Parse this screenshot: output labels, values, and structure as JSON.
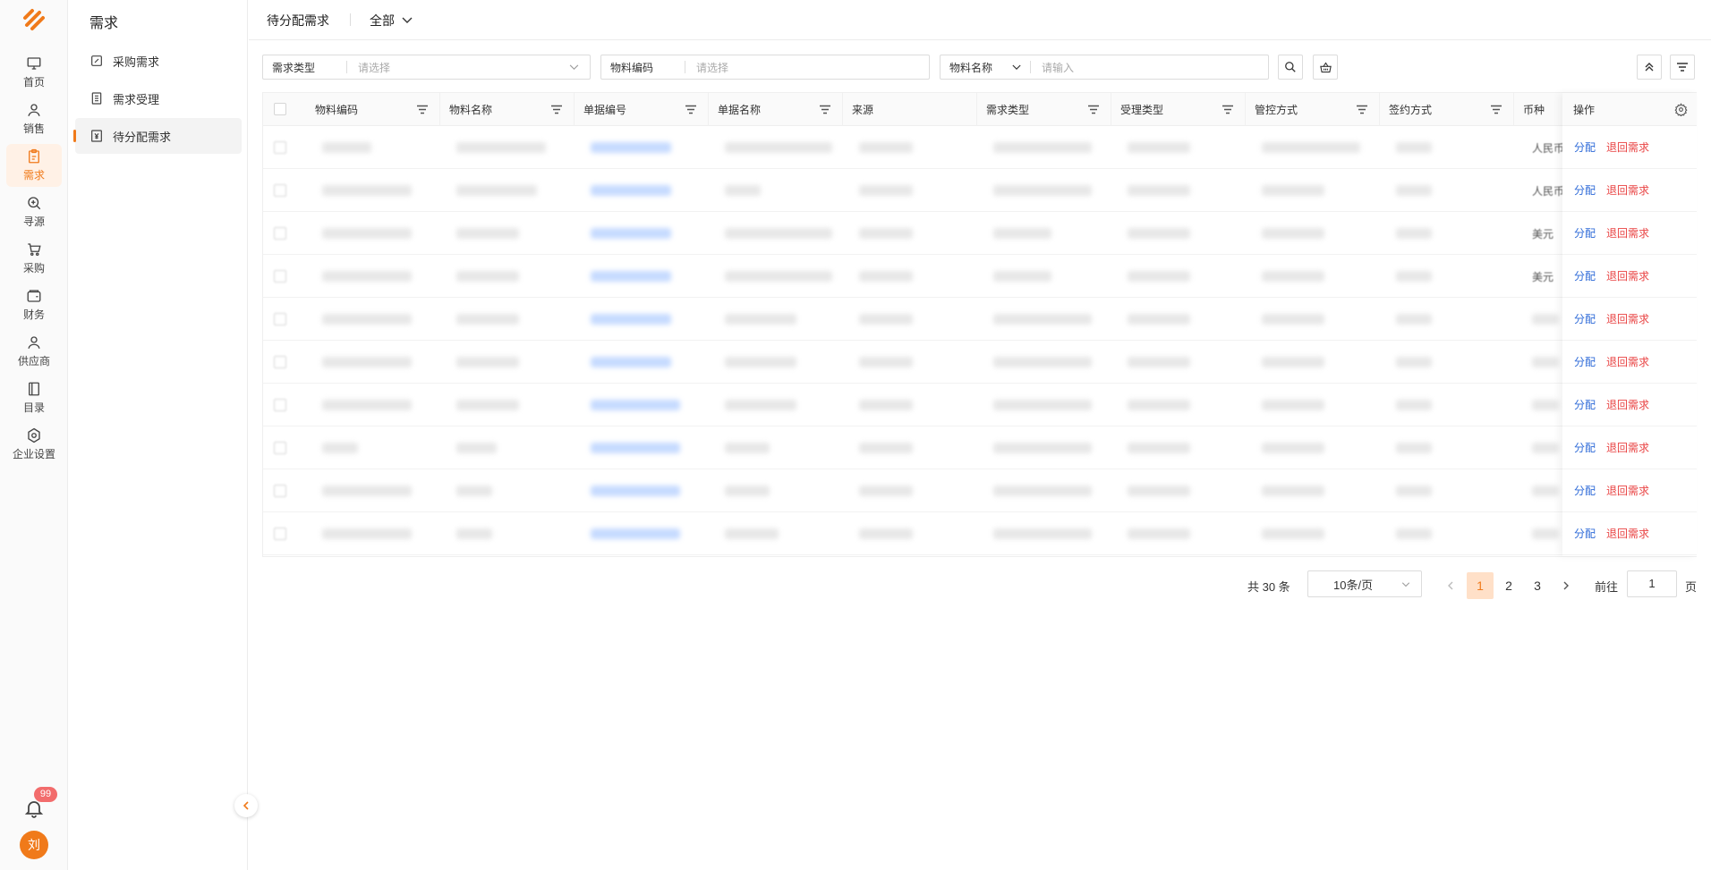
{
  "rail": {
    "items": [
      {
        "label": "首页",
        "icon": "monitor-icon"
      },
      {
        "label": "销售",
        "icon": "person-icon"
      },
      {
        "label": "需求",
        "icon": "clipboard-icon"
      },
      {
        "label": "寻源",
        "icon": "search-icon"
      },
      {
        "label": "采购",
        "icon": "cart-icon"
      },
      {
        "label": "财务",
        "icon": "wallet-icon"
      },
      {
        "label": "供应商",
        "icon": "supplier-icon"
      },
      {
        "label": "目录",
        "icon": "book-icon"
      },
      {
        "label": "企业设置",
        "icon": "settings-icon"
      }
    ],
    "active_index": 2,
    "notification_count": "99",
    "avatar_text": "刘",
    "accent": "#f07a1a"
  },
  "subnav": {
    "title": "需求",
    "items": [
      {
        "label": "采购需求",
        "icon": "edit-square-icon"
      },
      {
        "label": "需求受理",
        "icon": "list-icon"
      },
      {
        "label": "待分配需求",
        "icon": "yen-icon"
      }
    ],
    "active_index": 2
  },
  "header": {
    "title": "待分配需求",
    "scope": "全部"
  },
  "filters": {
    "type_label": "需求类型",
    "type_placeholder": "请选择",
    "code_label": "物料编码",
    "code_placeholder": "请选择",
    "name_label": "物料名称",
    "name_placeholder": "请输入"
  },
  "table": {
    "columns": [
      "物料编码",
      "物料名称",
      "单据编号",
      "单据名称",
      "来源",
      "需求类型",
      "受理类型",
      "管控方式",
      "签约方式",
      "币种"
    ],
    "action_header": "操作",
    "currency_values": [
      "人民币",
      "人民币",
      "美元",
      "美元",
      "",
      "",
      "",
      "",
      "",
      ""
    ],
    "actions": {
      "assign": "分配",
      "return": "退回需求"
    },
    "row_count": 10
  },
  "pagination": {
    "total": "共 30 条",
    "page_size": "10条/页",
    "pages": [
      "1",
      "2",
      "3"
    ],
    "current": "1",
    "goto_label": "前往",
    "goto_value": "1",
    "page_suffix": "页"
  }
}
